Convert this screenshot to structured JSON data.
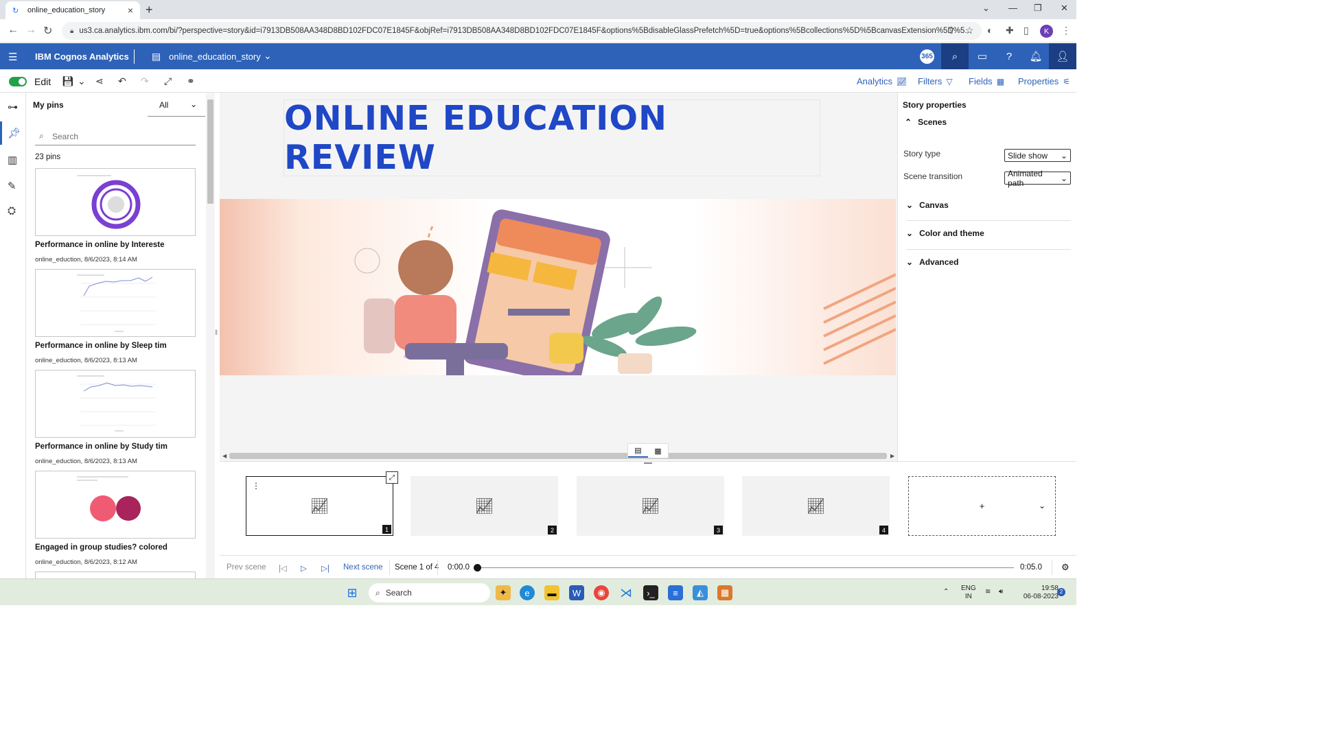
{
  "browser": {
    "tab_title": "online_education_story",
    "url": "us3.ca.analytics.ibm.com/bi/?perspective=story&id=i7913DB508AA348D8BD102FDC07E1845F&objRef=i7913DB508AA348D8BD102FDC07E1845F&options%5BdisableGlassPrefetch%5D=true&options%5Bcollections%5D%5BcanvasExtension%5D%5...",
    "profile_initial": "K"
  },
  "appbar": {
    "brand": "IBM Cognos Analytics",
    "doc_title": "online_education_story",
    "badge": "365"
  },
  "toolbar": {
    "edit_label": "Edit",
    "analytics": "Analytics",
    "filters": "Filters",
    "fields": "Fields",
    "properties": "Properties"
  },
  "pins": {
    "title": "My pins",
    "filter_value": "All",
    "search_placeholder": "Search",
    "count": "23 pins",
    "items": [
      {
        "title": "Performance in online by Intereste",
        "meta": "online_eduction, 8/6/2023, 8:14 AM"
      },
      {
        "title": "Performance in online by Sleep tim",
        "meta": "online_eduction, 8/6/2023, 8:13 AM"
      },
      {
        "title": "Performance in online by Study tim",
        "meta": "online_eduction, 8/6/2023, 8:13 AM"
      },
      {
        "title": "Engaged in group studies? colored",
        "meta": "online_eduction, 8/6/2023, 8:12 AM"
      }
    ]
  },
  "canvas": {
    "title": "ONLINE EDUCATION REVIEW"
  },
  "properties": {
    "title": "Story properties",
    "scenes": "Scenes",
    "story_type_label": "Story type",
    "story_type_value": "Slide show",
    "scene_transition_label": "Scene transition",
    "scene_transition_value": "Animated path",
    "canvas": "Canvas",
    "color_theme": "Color and theme",
    "advanced": "Advanced"
  },
  "scenes": {
    "numbers": [
      "1",
      "2",
      "3",
      "4"
    ],
    "add": "+"
  },
  "playbar": {
    "prev": "Prev scene",
    "next": "Next scene",
    "scene_of": "Scene 1 of 4",
    "start_time": "0:00.0",
    "end_time": "0:05.0"
  },
  "taskbar": {
    "search": "Search",
    "lang1": "ENG",
    "lang2": "IN",
    "time": "19:58",
    "date": "06-08-2023",
    "notif": "2"
  },
  "colors": {
    "brand_blue": "#2d62b8",
    "title_blue": "#1f47c6",
    "donut_purple": "#7b3fd1",
    "bubble_pink": "#ef5b73",
    "bubble_maroon": "#a8245a"
  }
}
